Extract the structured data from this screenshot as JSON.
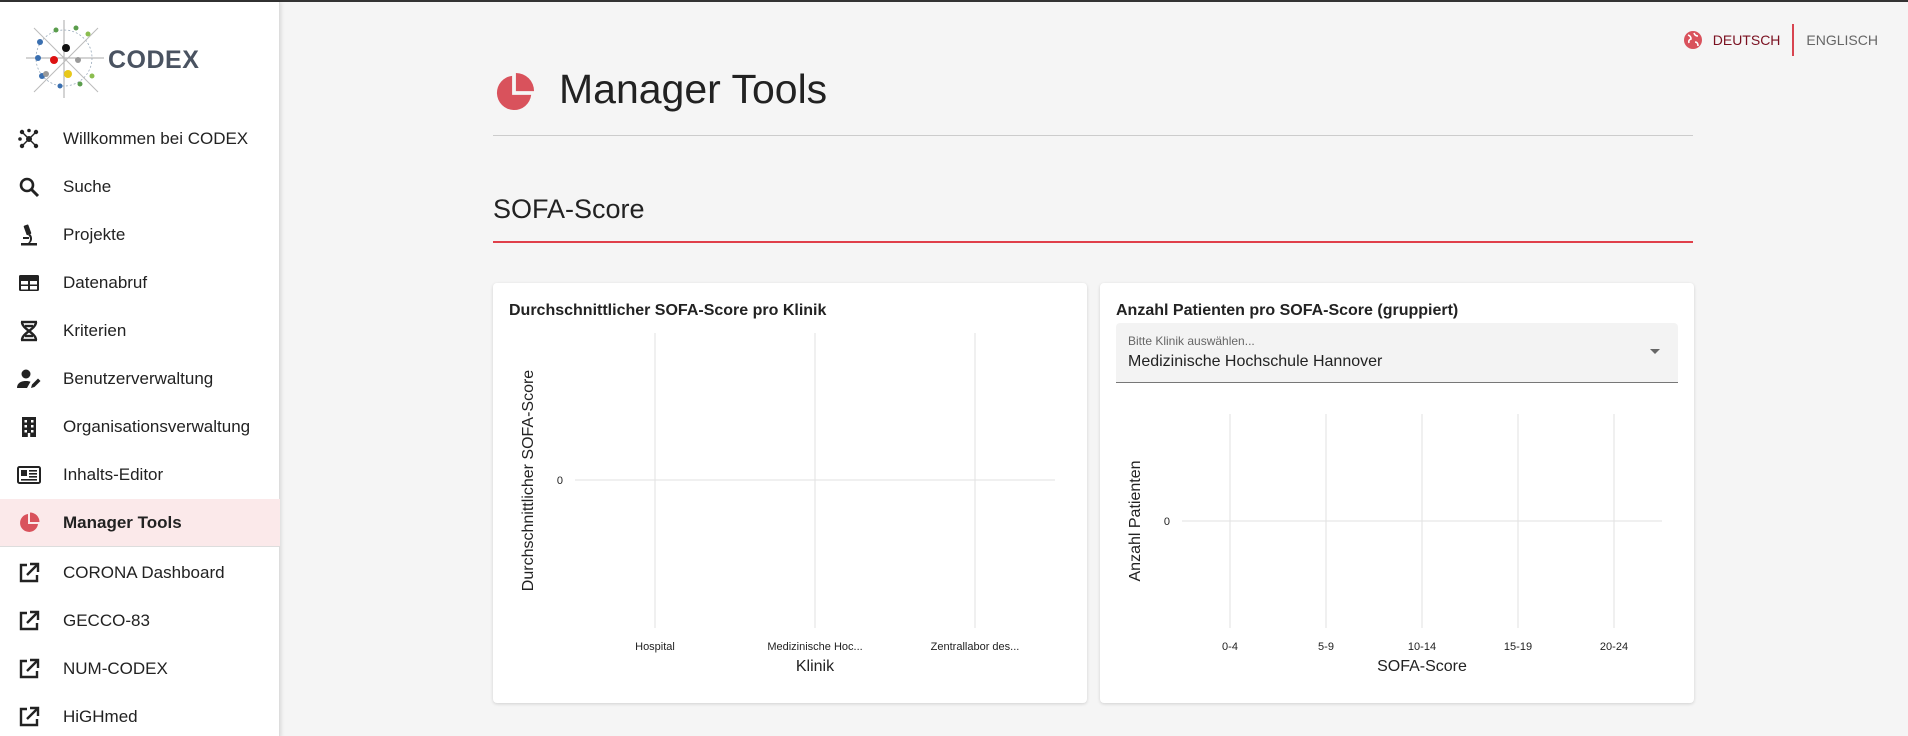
{
  "app": {
    "logo_text": "CODEX"
  },
  "sidebar": {
    "items": [
      {
        "label": "Willkommen bei CODEX",
        "icon": "network-icon"
      },
      {
        "label": "Suche",
        "icon": "search-icon"
      },
      {
        "label": "Projekte",
        "icon": "microscope-icon"
      },
      {
        "label": "Datenabruf",
        "icon": "table-icon"
      },
      {
        "label": "Kriterien",
        "icon": "dna-icon"
      },
      {
        "label": "Benutzerverwaltung",
        "icon": "user-edit-icon"
      },
      {
        "label": "Organisationsverwaltung",
        "icon": "building-icon"
      },
      {
        "label": "Inhalts-Editor",
        "icon": "newspaper-icon"
      },
      {
        "label": "Manager Tools",
        "icon": "pie-chart-icon",
        "active": true
      }
    ],
    "external": [
      {
        "label": "CORONA Dashboard",
        "icon": "external-link-icon"
      },
      {
        "label": "GECCO-83",
        "icon": "external-link-icon"
      },
      {
        "label": "NUM-CODEX",
        "icon": "external-link-icon"
      },
      {
        "label": "HiGHmed",
        "icon": "external-link-icon"
      }
    ]
  },
  "language": {
    "de": "DEUTSCH",
    "en": "ENGLISCH",
    "icon": "globe-icon"
  },
  "page": {
    "title": "Manager Tools",
    "section": "SOFA-Score"
  },
  "colors": {
    "accent": "#e0404a",
    "active_bg": "#fbe9ea"
  },
  "chart_data": [
    {
      "type": "bar",
      "title": "Durchschnittlicher SOFA-Score pro Klinik",
      "xlabel": "Klinik",
      "ylabel": "Durchschnittlicher SOFA-Score",
      "categories": [
        "Hospital",
        "Medizinische Hoc...",
        "Zentrallabor des..."
      ],
      "values": [
        0,
        0,
        0
      ],
      "yticks": [
        "0"
      ],
      "grid": true
    },
    {
      "type": "bar",
      "title": "Anzahl Patienten pro SOFA-Score (gruppiert)",
      "select_label": "Bitte Klinik auswählen...",
      "select_value": "Medizinische Hochschule Hannover",
      "xlabel": "SOFA-Score",
      "ylabel": "Anzahl Patienten",
      "categories": [
        "0-4",
        "5-9",
        "10-14",
        "15-19",
        "20-24"
      ],
      "values": [
        0,
        0,
        0,
        0,
        0
      ],
      "yticks": [
        "0"
      ],
      "grid": true
    }
  ]
}
